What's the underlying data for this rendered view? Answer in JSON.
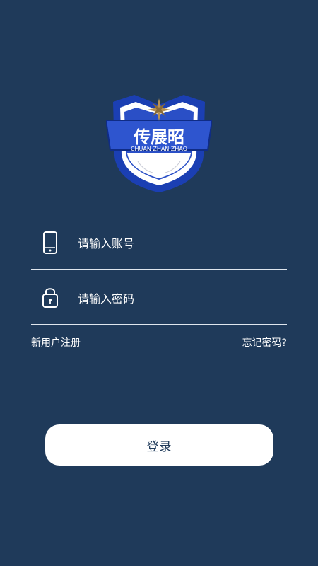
{
  "logo": {
    "title": "传展昭",
    "subtitle": "CHUAN ZHAN ZHAO",
    "colors": {
      "shield_blue": "#1b3fb3",
      "banner_blue": "#2a4fc6",
      "star_gold": "#b89252",
      "inner_white": "#ffffff"
    }
  },
  "account": {
    "placeholder": "请输入账号",
    "icon": "phone-icon"
  },
  "password": {
    "placeholder": "请输入密码",
    "icon": "lock-icon"
  },
  "links": {
    "register": "新用户注册",
    "forgot": "忘记密码?"
  },
  "login": {
    "label": "登录"
  },
  "colors": {
    "background": "#1f3a5a",
    "text": "#ffffff",
    "divider": "#dfe6ee"
  }
}
